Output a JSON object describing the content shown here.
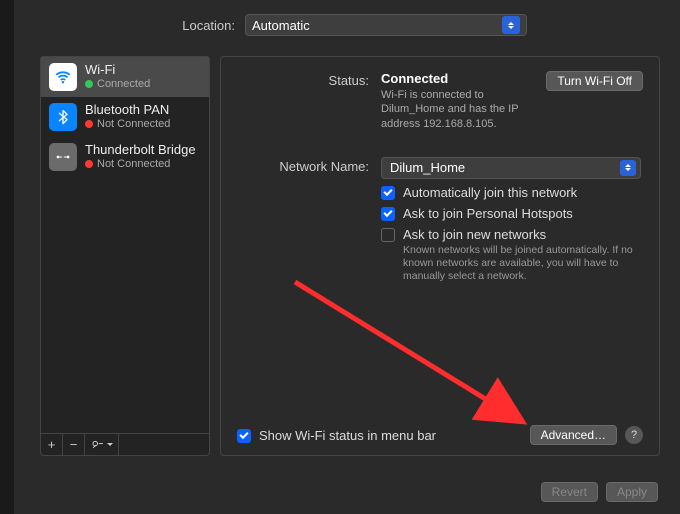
{
  "location": {
    "label": "Location:",
    "value": "Automatic"
  },
  "sidebar": {
    "items": [
      {
        "name": "Wi-Fi",
        "status": "Connected",
        "statusColor": "green",
        "icon": "wifi"
      },
      {
        "name": "Bluetooth PAN",
        "status": "Not Connected",
        "statusColor": "red",
        "icon": "bluetooth"
      },
      {
        "name": "Thunderbolt Bridge",
        "status": "Not Connected",
        "statusColor": "red",
        "icon": "thunderbolt"
      }
    ]
  },
  "main": {
    "status_label": "Status:",
    "status_value": "Connected",
    "toggle_btn": "Turn Wi-Fi Off",
    "status_desc": "Wi-Fi is connected to Dilum_Home and has the IP address 192.168.8.105.",
    "network_label": "Network Name:",
    "network_value": "Dilum_Home",
    "auto_join": "Automatically join this network",
    "ask_hotspot": "Ask to join Personal Hotspots",
    "ask_new": "Ask to join new networks",
    "ask_new_desc": "Known networks will be joined automatically. If no known networks are available, you will have to manually select a network.",
    "show_menu": "Show Wi-Fi status in menu bar",
    "advanced_btn": "Advanced…",
    "help": "?"
  },
  "footer": {
    "revert": "Revert",
    "apply": "Apply"
  }
}
